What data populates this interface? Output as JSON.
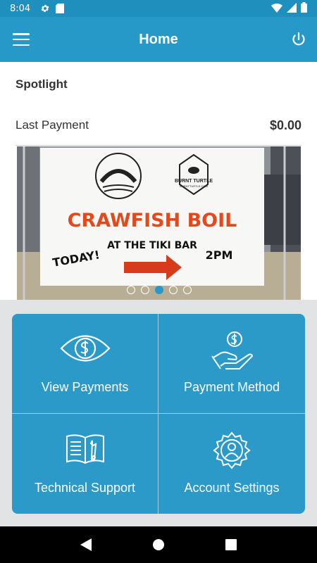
{
  "status_bar": {
    "time": "8:04",
    "icons": [
      "gear-icon",
      "sd-card-icon",
      "wifi-icon",
      "signal-icon",
      "battery-icon"
    ]
  },
  "app_bar": {
    "title": "Home",
    "left_icon": "hamburger-menu-icon",
    "right_icon": "power-icon",
    "color": "#2799c8"
  },
  "spotlight": {
    "title": "Spotlight",
    "last_payment_label": "Last Payment",
    "last_payment_amount": "$0.00"
  },
  "carousel": {
    "image_text": {
      "headline": "CRAWFISH BOIL",
      "subline": "AT THE TIKI BAR",
      "left": "TODAY!",
      "right": "2PM",
      "logo_right": "BURNT TURTLE",
      "logo_right_url": "BURNTTURTLE.COM"
    },
    "dot_count": 5,
    "active_dot": 3
  },
  "tiles": [
    {
      "label": "View Payments",
      "icon": "eye-dollar-icon"
    },
    {
      "label": "Payment Method",
      "icon": "hand-dollar-icon"
    },
    {
      "label": "Technical Support",
      "icon": "manual-wrench-icon"
    },
    {
      "label": "Account Settings",
      "icon": "gear-user-icon"
    }
  ],
  "nav_bar": {
    "buttons": [
      "back-icon",
      "home-icon",
      "recents-icon"
    ]
  }
}
